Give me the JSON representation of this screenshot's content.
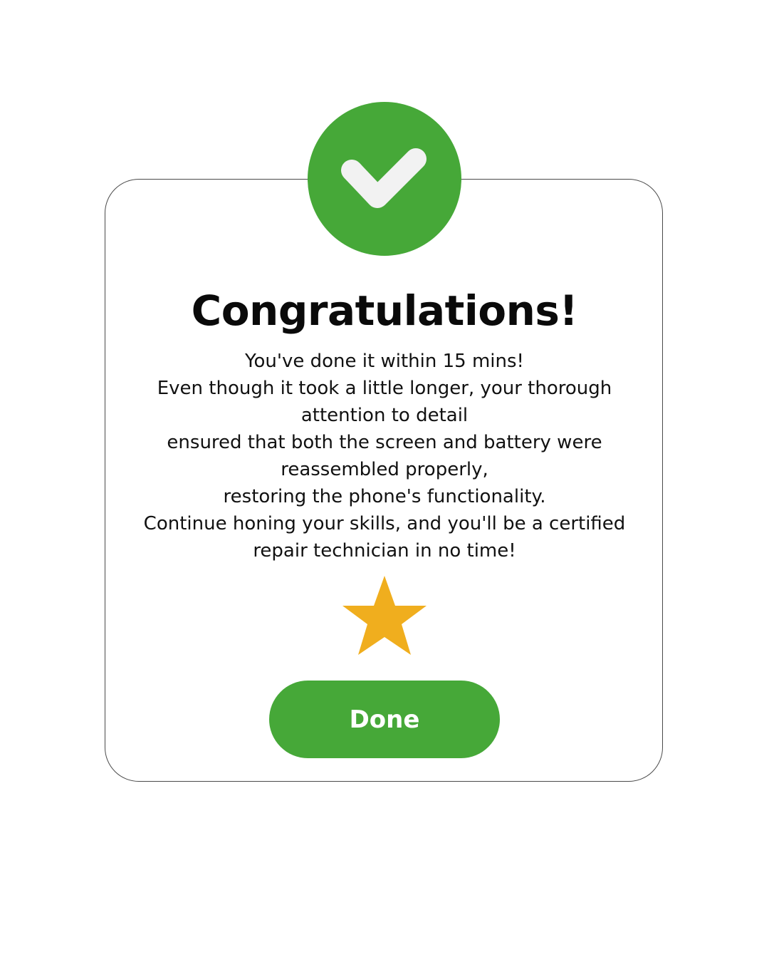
{
  "dialog": {
    "title": "Congratulations!",
    "message_lines": [
      "You've done it within 15 mins!",
      "Even though it took a little longer, your thorough",
      "attention to detail",
      "ensured that both the screen and battery were",
      "reassembled properly,",
      "restoring the phone's functionality.",
      "Continue honing your skills, and you'll be a certified",
      "repair technician in no time!"
    ],
    "rating": {
      "stars_shown": 1
    },
    "done_label": "Done",
    "icons": {
      "badge": "checkmark-icon",
      "rating": "star-icon"
    },
    "colors": {
      "accent_green": "#46a838",
      "star_gold": "#f0ae1e",
      "check_white": "#f2f2f2"
    }
  }
}
